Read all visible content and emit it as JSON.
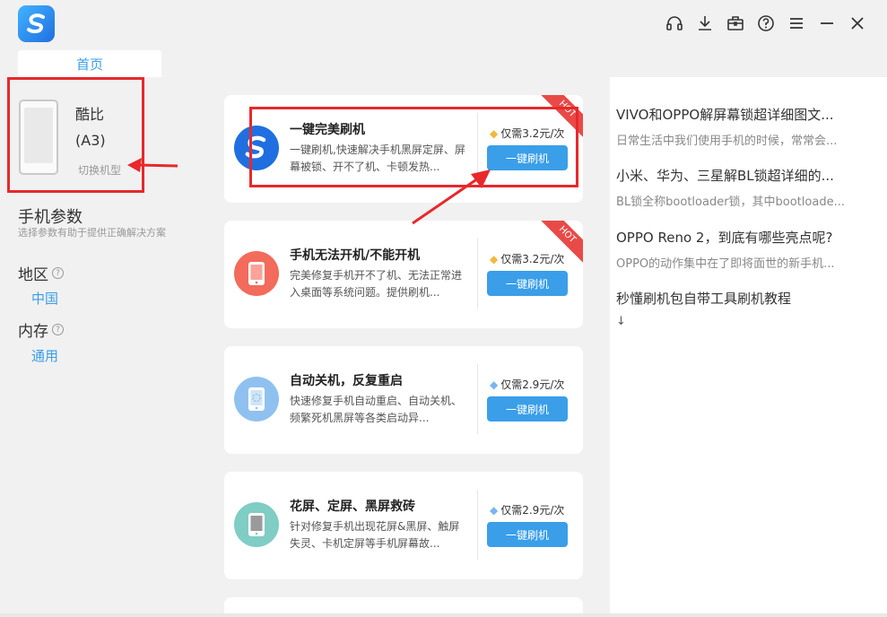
{
  "header": {
    "tab_home": "首页",
    "icons": [
      "headset-icon",
      "download-icon",
      "toolbox-icon",
      "help-icon",
      "menu-icon",
      "minimize-icon",
      "close-icon"
    ]
  },
  "device": {
    "name": "酷比",
    "model": "(A3)",
    "switch_label": "切换机型"
  },
  "params": {
    "title": "手机参数",
    "subtitle": "选择参数有助于提供正确解决方案",
    "region_label": "地区",
    "region_value": "中国",
    "memory_label": "内存",
    "memory_value": "通用"
  },
  "cards": [
    {
      "title": "一键完美刷机",
      "desc": "一键刷机,快速解决手机黑屏定屏、屏幕被锁、开不了机、卡顿发热...",
      "price": "仅需3.2元/次",
      "button": "一键刷机",
      "badge": "HOT",
      "tier": "gold"
    },
    {
      "title": "手机无法开机/不能开机",
      "desc": "完美修复手机开不了机、无法正常进入桌面等系统问题。提供刷机...",
      "price": "仅需3.2元/次",
      "button": "一键刷机",
      "badge": "HOT",
      "tier": "gold"
    },
    {
      "title": "自动关机，反复重启",
      "desc": "快速修复手机自动重启、自动关机、频繁死机黑屏等各类启动异...",
      "price": "仅需2.9元/次",
      "button": "一键刷机",
      "badge": "",
      "tier": "silver"
    },
    {
      "title": "花屏、定屏、黑屏救砖",
      "desc": "针对修复手机出现花屏&黑屏、触屏失灵、卡机定屏等手机屏幕故...",
      "price": "仅需2.9元/次",
      "button": "一键刷机",
      "badge": "",
      "tier": "silver"
    }
  ],
  "articles": [
    {
      "title": "VIVO和OPPO解屏幕锁超详细图文...",
      "sub": "日常生活中我们使用手机的时候，常常会..."
    },
    {
      "title": "小米、华为、三星解BL锁超详细的...",
      "sub": "BL锁全称bootloader锁，其中bootloade..."
    },
    {
      "title": "OPPO Reno 2，到底有哪些亮点呢?",
      "sub": "OPPO的动作集中在了即将面世的新手机..."
    },
    {
      "title": "秒懂刷机包自带工具刷机教程",
      "sub": "↓"
    }
  ],
  "colors": {
    "accent": "#3a9ee8",
    "annotation_red": "#e8282b",
    "hot": "#e94a47",
    "icon_bg": [
      "#1f6fe0",
      "#f26b5b",
      "#8fc1f0",
      "#7fcdc4"
    ]
  }
}
